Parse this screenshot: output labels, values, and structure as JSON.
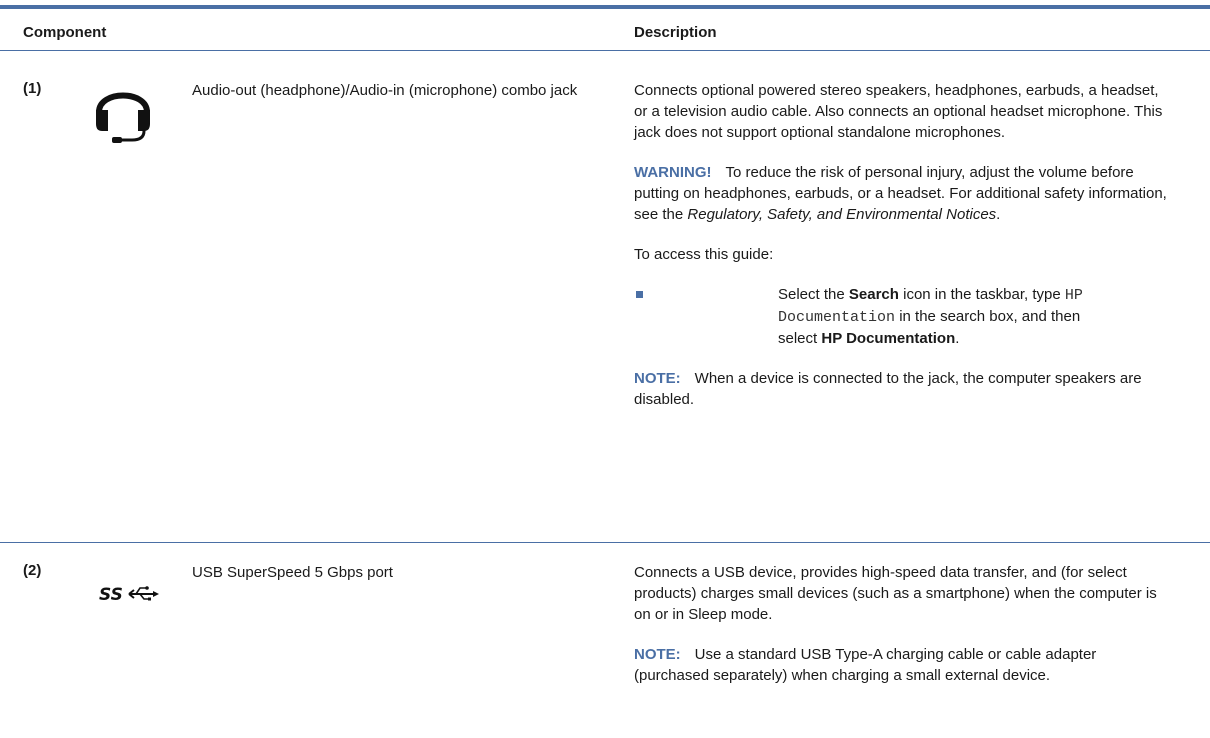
{
  "table": {
    "header": {
      "component": "Component",
      "description": "Description"
    },
    "rows": [
      {
        "number": "(1)",
        "icon": "headset-icon",
        "component": "Audio-out (headphone)/Audio-in (microphone) combo jack",
        "desc_intro": "Connects optional powered stereo speakers, headphones, earbuds, a headset, or a television audio cable. Also connects an optional headset microphone. This jack does not support optional standalone microphones.",
        "warning_label": "WARNING!",
        "warning_text": "To reduce the risk of personal injury, adjust the volume before putting on headphones, earbuds, or a headset. For additional safety information, see the",
        "warning_doc_title": "Regulatory, Safety, and Environmental Notices",
        "warning_end": ".",
        "access_intro": "To access this guide:",
        "bullet_pre": "Select the",
        "bullet_search": "Search",
        "bullet_mid": "icon in the taskbar, type",
        "bullet_code": "HP Documentation",
        "bullet_mid2": "in the search box, and then select",
        "bullet_target": "HP Documentation",
        "bullet_end": ".",
        "note_label": "NOTE:",
        "note_text": "When a device is connected to the jack, the computer speakers are disabled."
      },
      {
        "number": "(2)",
        "icon": "usb-superspeed-icon",
        "icon_text": "SS",
        "component": "USB SuperSpeed 5 Gbps port",
        "desc_intro": "Connects a USB device, provides high-speed data transfer, and (for select products) charges small devices (such as a smartphone) when the computer is on or in Sleep mode.",
        "note_label": "NOTE:",
        "note_text": "Use a standard USB Type-A charging cable or cable adapter (purchased separately) when charging a small external device."
      }
    ]
  },
  "colors": {
    "accent": "#4a6fa5",
    "text": "#1a1a1a"
  }
}
